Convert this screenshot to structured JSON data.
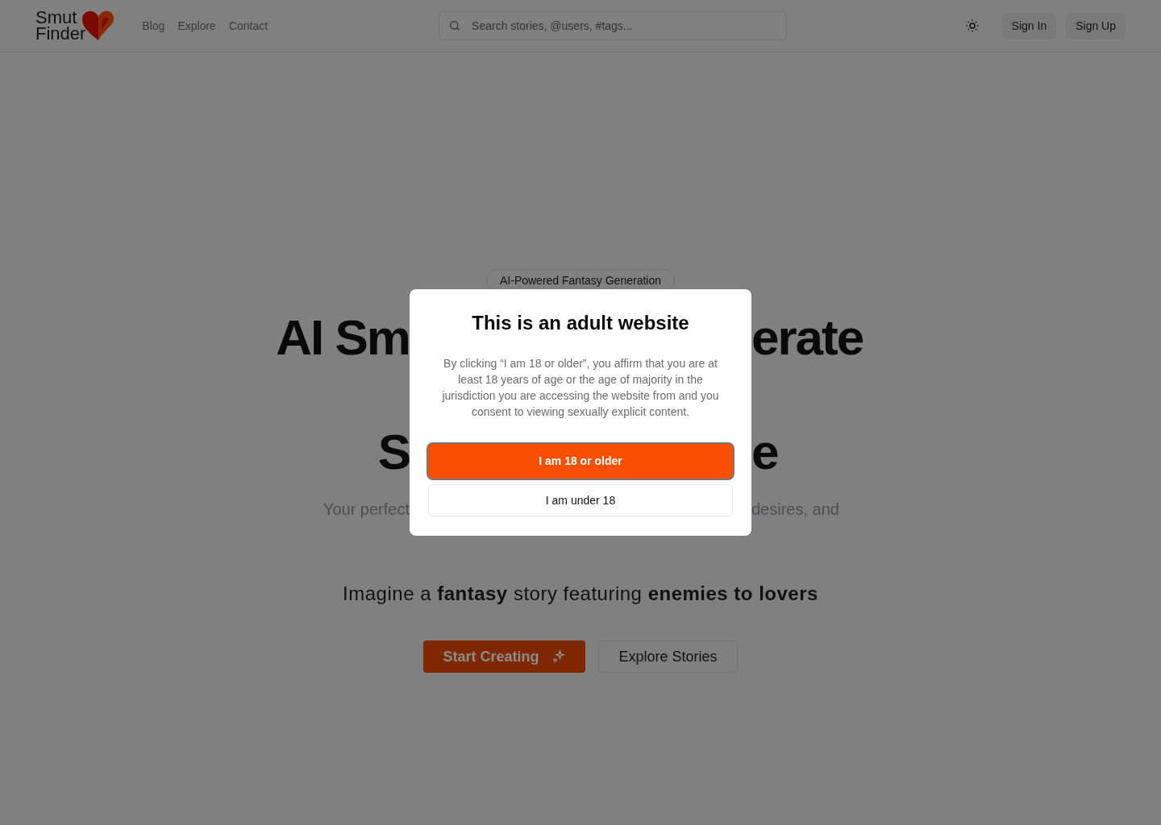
{
  "header": {
    "logo": {
      "line_1": "Smut",
      "line_2": "Finder"
    },
    "nav": [
      "Blog",
      "Explore",
      "Contact"
    ],
    "search": {
      "placeholder": "Search stories, @users, #tags..."
    },
    "buttons": [
      "Sign In",
      "Sign Up"
    ]
  },
  "hero": {
    "badge": "AI-Powered Fantasy Generation",
    "headline_rows": [
      {
        "left": "AI Sm",
        "right": "erate"
      },
      {
        "left": "S",
        "right": "e"
      }
    ],
    "subtitle": {
      "left": "Your perfect",
      "right": "desires, and"
    },
    "prompt": "Imagine a **fantasy** story featuring **enemies to lovers**",
    "primary_button": "Start Creating",
    "secondary_button": "Explore Stories"
  },
  "modal": {
    "title": "This is an adult website",
    "body": "By clicking “I am 18 or older”, you affirm that you are at least 18 years of age or the age of majority in the jurisdiction you are accessing the website from and you consent to viewing sexually explicit content.",
    "confirm": "I am 18 or older",
    "decline": "I am under 18"
  }
}
